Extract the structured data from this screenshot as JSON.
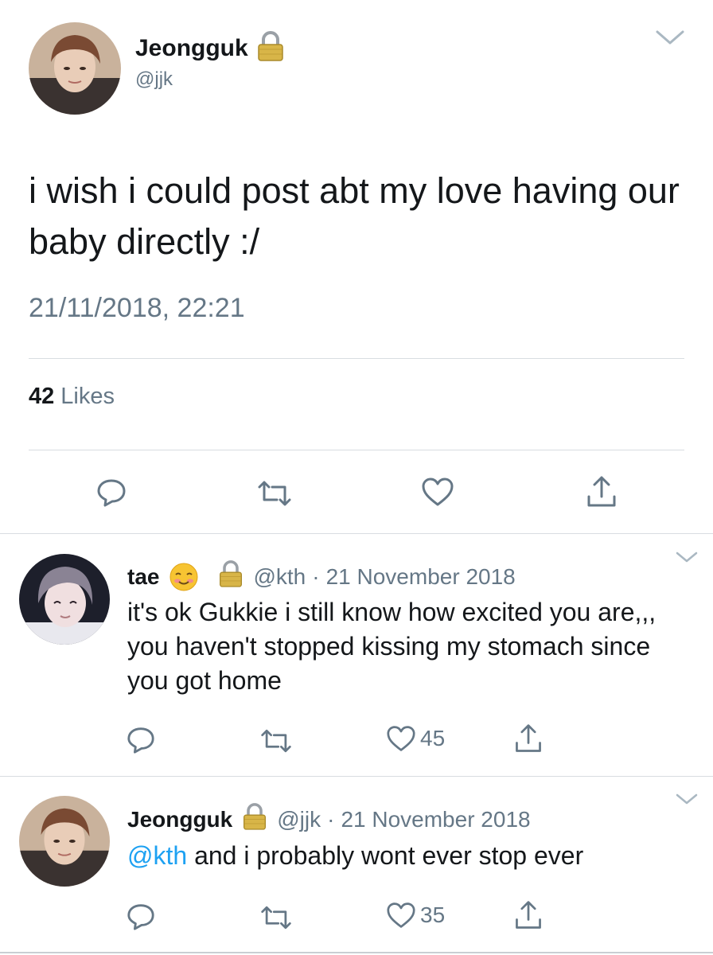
{
  "main_tweet": {
    "display_name": "Jeongguk",
    "handle": "@jjk",
    "text": "i wish i could post abt my love having our baby directly :/",
    "timestamp": "21/11/2018, 22:21",
    "likes_count": "42",
    "likes_label": "Likes",
    "avatar_icon": "avatar-jeongguk",
    "lock_icon": "lock-icon"
  },
  "replies": [
    {
      "display_name": "tae",
      "emoji": "☺️",
      "handle": "@kth",
      "separator": "·",
      "date": "21 November 2018",
      "text": "it's ok Gukkie i still know how excited you are,,, you haven't stopped kissing my stomach since you got home",
      "like_count": "45"
    },
    {
      "display_name": "Jeongguk",
      "handle": "@jjk",
      "separator": "·",
      "date": "21 November 2018",
      "mention": "@kth",
      "text": " and i probably wont ever stop ever",
      "like_count": "35"
    }
  ],
  "colors": {
    "text": "#14171a",
    "muted": "#657786",
    "link": "#1da1f2",
    "divider": "#d8dde1"
  }
}
